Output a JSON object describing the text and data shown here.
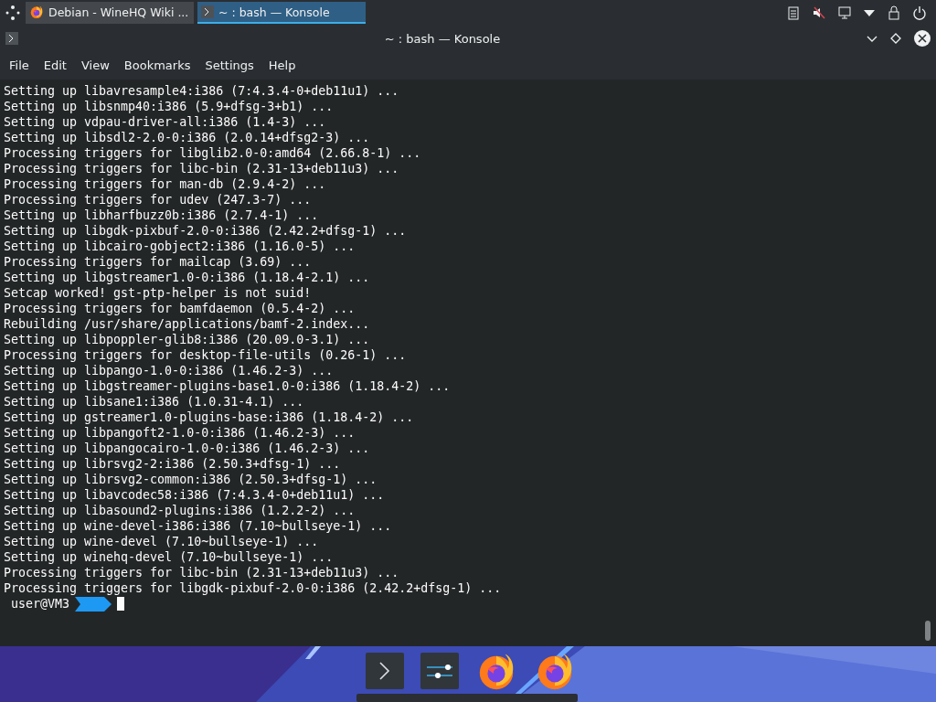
{
  "panel": {
    "tasks": [
      {
        "label": "Debian - WineHQ Wiki ...",
        "kind": "browser",
        "selected": false
      },
      {
        "label": "~ : bash — Konsole",
        "kind": "terminal",
        "selected": true
      }
    ]
  },
  "window": {
    "title": "~ : bash — Konsole"
  },
  "menu": [
    "File",
    "Edit",
    "View",
    "Bookmarks",
    "Settings",
    "Help"
  ],
  "terminal": {
    "lines": [
      "Setting up libavresample4:i386 (7:4.3.4-0+deb11u1) ...",
      "Setting up libsnmp40:i386 (5.9+dfsg-3+b1) ...",
      "Setting up vdpau-driver-all:i386 (1.4-3) ...",
      "Setting up libsdl2-2.0-0:i386 (2.0.14+dfsg2-3) ...",
      "Processing triggers for libglib2.0-0:amd64 (2.66.8-1) ...",
      "Processing triggers for libc-bin (2.31-13+deb11u3) ...",
      "Processing triggers for man-db (2.9.4-2) ...",
      "Processing triggers for udev (247.3-7) ...",
      "Setting up libharfbuzz0b:i386 (2.7.4-1) ...",
      "Setting up libgdk-pixbuf-2.0-0:i386 (2.42.2+dfsg-1) ...",
      "Setting up libcairo-gobject2:i386 (1.16.0-5) ...",
      "Processing triggers for mailcap (3.69) ...",
      "Setting up libgstreamer1.0-0:i386 (1.18.4-2.1) ...",
      "Setcap worked! gst-ptp-helper is not suid!",
      "Processing triggers for bamfdaemon (0.5.4-2) ...",
      "Rebuilding /usr/share/applications/bamf-2.index...",
      "Setting up libpoppler-glib8:i386 (20.09.0-3.1) ...",
      "Processing triggers for desktop-file-utils (0.26-1) ...",
      "Setting up libpango-1.0-0:i386 (1.46.2-3) ...",
      "Setting up libgstreamer-plugins-base1.0-0:i386 (1.18.4-2) ...",
      "Setting up libsane1:i386 (1.0.31-4.1) ...",
      "Setting up gstreamer1.0-plugins-base:i386 (1.18.4-2) ...",
      "Setting up libpangoft2-1.0-0:i386 (1.46.2-3) ...",
      "Setting up libpangocairo-1.0-0:i386 (1.46.2-3) ...",
      "Setting up librsvg2-2:i386 (2.50.3+dfsg-1) ...",
      "Setting up librsvg2-common:i386 (2.50.3+dfsg-1) ...",
      "Setting up libavcodec58:i386 (7:4.3.4-0+deb11u1) ...",
      "Setting up libasound2-plugins:i386 (1.2.2-2) ...",
      "Setting up wine-devel-i386:i386 (7.10~bullseye-1) ...",
      "Setting up wine-devel (7.10~bullseye-1) ...",
      "Setting up winehq-devel (7.10~bullseye-1) ...",
      "Processing triggers for libc-bin (2.31-13+deb11u3) ...",
      "Processing triggers for libgdk-pixbuf-2.0-0:i386 (2.42.2+dfsg-1) ..."
    ],
    "prompt": "user@VM3"
  },
  "dock": [
    {
      "kind": "terminal"
    },
    {
      "kind": "mixer"
    },
    {
      "kind": "browser"
    },
    {
      "kind": "browser"
    }
  ]
}
